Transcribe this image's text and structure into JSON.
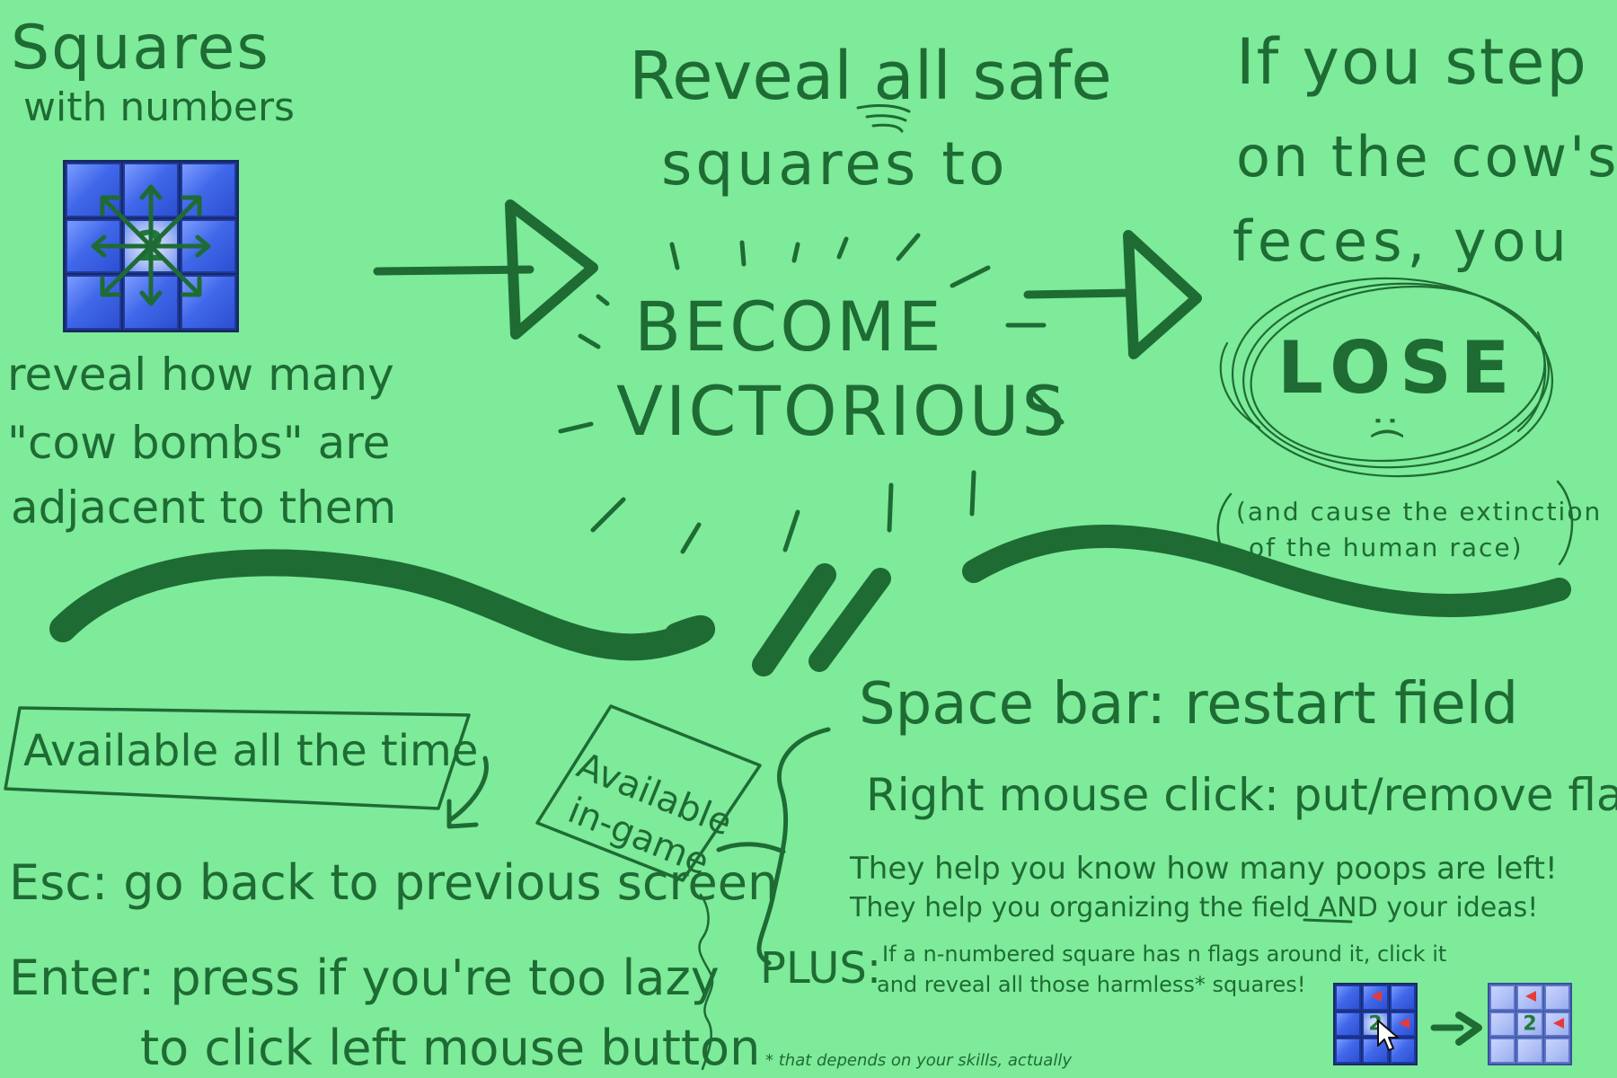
{
  "squares_note": {
    "heading_line1": "Squares",
    "heading_line2": "with numbers",
    "example_number": "2",
    "desc_line1": "reveal how many",
    "desc_line2": "\"cow bombs\" are",
    "desc_line3": "adjacent to them"
  },
  "win_note": {
    "line1": "Reveal all safe",
    "emphasis": "all",
    "line2": "squares to",
    "big_line1": "BECOME",
    "big_line2": "VICTORIOUS"
  },
  "lose_note": {
    "line1": "If you step",
    "line2": "on the cow's",
    "line3": "feces, you",
    "big": "LOSE",
    "face": ":(",
    "aside_line1": "(and cause the extinction",
    "aside_line2": "of the human race)"
  },
  "always_box": {
    "label": "Available all the time",
    "esc_line": "Esc: go back to previous screen",
    "enter_line1": "Enter: press if you're too lazy",
    "enter_line2": "to click left mouse button"
  },
  "ingame_box": {
    "label_line1": "Available",
    "label_line2": "in-game",
    "space_line": "Space bar: restart field",
    "right_click_line": "Right mouse click: put/remove flags!",
    "flags_line1": "They help you know how many poops are left!",
    "flags_line2": "They help you organizing the field AND your ideas!",
    "plus_label": "PLUS:",
    "plus_line1": "If a n-numbered square has n flags around it, click it",
    "plus_line2": "and reveal all those harmless* squares!",
    "example_number": "2"
  },
  "footnote": "* that depends on your skills, actually",
  "colors": {
    "background": "#7deb9a",
    "ink": "#1f6b34",
    "tile_blue": "#3a5fe0",
    "flag_red": "#e63a3a"
  }
}
